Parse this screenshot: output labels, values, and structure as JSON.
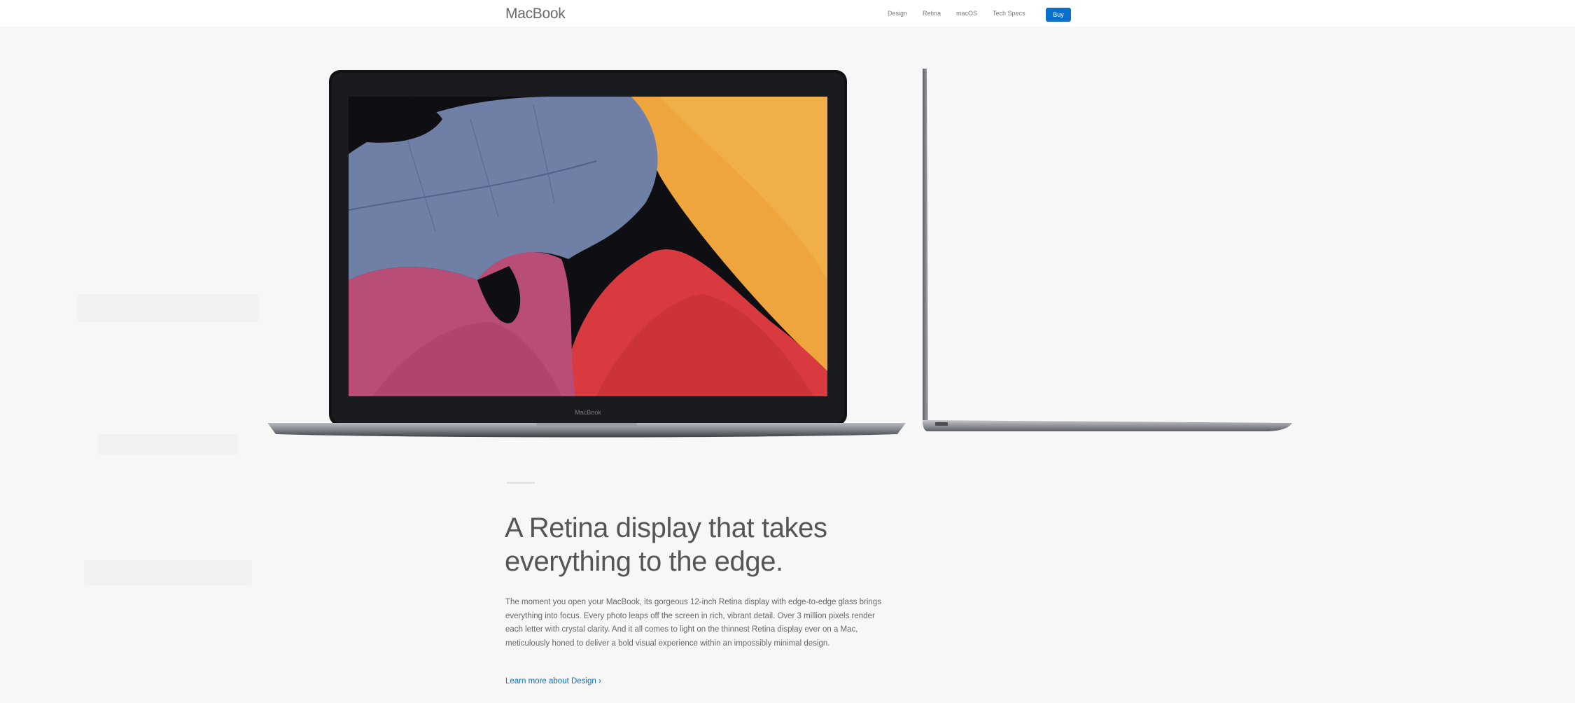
{
  "nav": {
    "brand": "MacBook",
    "links": [
      "Design",
      "Retina",
      "macOS",
      "Tech Specs"
    ],
    "buy_label": "Buy"
  },
  "product": {
    "logo_text": "MacBook"
  },
  "section": {
    "headline_line1": "A Retina display that takes",
    "headline_line2": "everything to the edge.",
    "body": "The moment you open your MacBook, its gorgeous 12-inch Retina display with edge-to-edge glass brings everything into focus. Every photo leaps off the screen in rich, vibrant detail. Over 3 million pixels render each letter with crystal clarity. And it all comes to light on the thinnest Retina display ever on a Mac, meticulously honed to deliver a bold visual experience within an impossibly minimal design.",
    "link_label": "Learn more about Design ›"
  },
  "colors": {
    "accent": "#0a70c9",
    "background": "#f7f7f8",
    "leaf_blue": "#6f7fa6",
    "leaf_orange": "#efa53d",
    "leaf_red": "#d83a3f",
    "leaf_pink": "#b84d77"
  }
}
